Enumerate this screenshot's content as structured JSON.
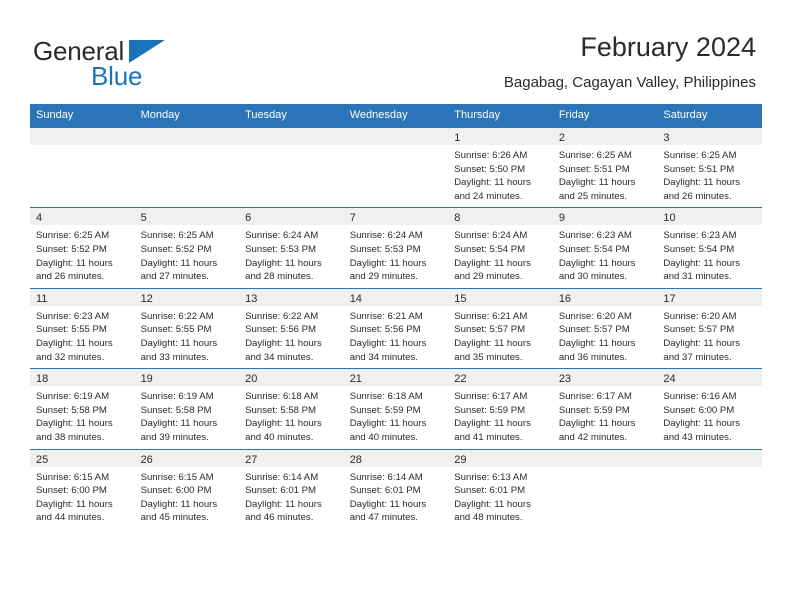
{
  "brand": {
    "name_part1": "General",
    "name_part2": "Blue",
    "triangle_color": "#1a74bb"
  },
  "header": {
    "title": "February 2024",
    "subtitle": "Bagabag, Cagayan Valley, Philippines"
  },
  "theme": {
    "header_blue": "#2b74b8",
    "daynum_band": "#f0f0f0",
    "text": "#2b2b2b"
  },
  "weekdays": [
    "Sunday",
    "Monday",
    "Tuesday",
    "Wednesday",
    "Thursday",
    "Friday",
    "Saturday"
  ],
  "weeks": [
    [
      {
        "day": "",
        "blank": true
      },
      {
        "day": "",
        "blank": true
      },
      {
        "day": "",
        "blank": true
      },
      {
        "day": "",
        "blank": true
      },
      {
        "day": "1",
        "sunrise": "Sunrise: 6:26 AM",
        "sunset": "Sunset: 5:50 PM",
        "daylight1": "Daylight: 11 hours",
        "daylight2": "and 24 minutes."
      },
      {
        "day": "2",
        "sunrise": "Sunrise: 6:25 AM",
        "sunset": "Sunset: 5:51 PM",
        "daylight1": "Daylight: 11 hours",
        "daylight2": "and 25 minutes."
      },
      {
        "day": "3",
        "sunrise": "Sunrise: 6:25 AM",
        "sunset": "Sunset: 5:51 PM",
        "daylight1": "Daylight: 11 hours",
        "daylight2": "and 26 minutes."
      }
    ],
    [
      {
        "day": "4",
        "sunrise": "Sunrise: 6:25 AM",
        "sunset": "Sunset: 5:52 PM",
        "daylight1": "Daylight: 11 hours",
        "daylight2": "and 26 minutes."
      },
      {
        "day": "5",
        "sunrise": "Sunrise: 6:25 AM",
        "sunset": "Sunset: 5:52 PM",
        "daylight1": "Daylight: 11 hours",
        "daylight2": "and 27 minutes."
      },
      {
        "day": "6",
        "sunrise": "Sunrise: 6:24 AM",
        "sunset": "Sunset: 5:53 PM",
        "daylight1": "Daylight: 11 hours",
        "daylight2": "and 28 minutes."
      },
      {
        "day": "7",
        "sunrise": "Sunrise: 6:24 AM",
        "sunset": "Sunset: 5:53 PM",
        "daylight1": "Daylight: 11 hours",
        "daylight2": "and 29 minutes."
      },
      {
        "day": "8",
        "sunrise": "Sunrise: 6:24 AM",
        "sunset": "Sunset: 5:54 PM",
        "daylight1": "Daylight: 11 hours",
        "daylight2": "and 29 minutes."
      },
      {
        "day": "9",
        "sunrise": "Sunrise: 6:23 AM",
        "sunset": "Sunset: 5:54 PM",
        "daylight1": "Daylight: 11 hours",
        "daylight2": "and 30 minutes."
      },
      {
        "day": "10",
        "sunrise": "Sunrise: 6:23 AM",
        "sunset": "Sunset: 5:54 PM",
        "daylight1": "Daylight: 11 hours",
        "daylight2": "and 31 minutes."
      }
    ],
    [
      {
        "day": "11",
        "sunrise": "Sunrise: 6:23 AM",
        "sunset": "Sunset: 5:55 PM",
        "daylight1": "Daylight: 11 hours",
        "daylight2": "and 32 minutes."
      },
      {
        "day": "12",
        "sunrise": "Sunrise: 6:22 AM",
        "sunset": "Sunset: 5:55 PM",
        "daylight1": "Daylight: 11 hours",
        "daylight2": "and 33 minutes."
      },
      {
        "day": "13",
        "sunrise": "Sunrise: 6:22 AM",
        "sunset": "Sunset: 5:56 PM",
        "daylight1": "Daylight: 11 hours",
        "daylight2": "and 34 minutes."
      },
      {
        "day": "14",
        "sunrise": "Sunrise: 6:21 AM",
        "sunset": "Sunset: 5:56 PM",
        "daylight1": "Daylight: 11 hours",
        "daylight2": "and 34 minutes."
      },
      {
        "day": "15",
        "sunrise": "Sunrise: 6:21 AM",
        "sunset": "Sunset: 5:57 PM",
        "daylight1": "Daylight: 11 hours",
        "daylight2": "and 35 minutes."
      },
      {
        "day": "16",
        "sunrise": "Sunrise: 6:20 AM",
        "sunset": "Sunset: 5:57 PM",
        "daylight1": "Daylight: 11 hours",
        "daylight2": "and 36 minutes."
      },
      {
        "day": "17",
        "sunrise": "Sunrise: 6:20 AM",
        "sunset": "Sunset: 5:57 PM",
        "daylight1": "Daylight: 11 hours",
        "daylight2": "and 37 minutes."
      }
    ],
    [
      {
        "day": "18",
        "sunrise": "Sunrise: 6:19 AM",
        "sunset": "Sunset: 5:58 PM",
        "daylight1": "Daylight: 11 hours",
        "daylight2": "and 38 minutes."
      },
      {
        "day": "19",
        "sunrise": "Sunrise: 6:19 AM",
        "sunset": "Sunset: 5:58 PM",
        "daylight1": "Daylight: 11 hours",
        "daylight2": "and 39 minutes."
      },
      {
        "day": "20",
        "sunrise": "Sunrise: 6:18 AM",
        "sunset": "Sunset: 5:58 PM",
        "daylight1": "Daylight: 11 hours",
        "daylight2": "and 40 minutes."
      },
      {
        "day": "21",
        "sunrise": "Sunrise: 6:18 AM",
        "sunset": "Sunset: 5:59 PM",
        "daylight1": "Daylight: 11 hours",
        "daylight2": "and 40 minutes."
      },
      {
        "day": "22",
        "sunrise": "Sunrise: 6:17 AM",
        "sunset": "Sunset: 5:59 PM",
        "daylight1": "Daylight: 11 hours",
        "daylight2": "and 41 minutes."
      },
      {
        "day": "23",
        "sunrise": "Sunrise: 6:17 AM",
        "sunset": "Sunset: 5:59 PM",
        "daylight1": "Daylight: 11 hours",
        "daylight2": "and 42 minutes."
      },
      {
        "day": "24",
        "sunrise": "Sunrise: 6:16 AM",
        "sunset": "Sunset: 6:00 PM",
        "daylight1": "Daylight: 11 hours",
        "daylight2": "and 43 minutes."
      }
    ],
    [
      {
        "day": "25",
        "sunrise": "Sunrise: 6:15 AM",
        "sunset": "Sunset: 6:00 PM",
        "daylight1": "Daylight: 11 hours",
        "daylight2": "and 44 minutes."
      },
      {
        "day": "26",
        "sunrise": "Sunrise: 6:15 AM",
        "sunset": "Sunset: 6:00 PM",
        "daylight1": "Daylight: 11 hours",
        "daylight2": "and 45 minutes."
      },
      {
        "day": "27",
        "sunrise": "Sunrise: 6:14 AM",
        "sunset": "Sunset: 6:01 PM",
        "daylight1": "Daylight: 11 hours",
        "daylight2": "and 46 minutes."
      },
      {
        "day": "28",
        "sunrise": "Sunrise: 6:14 AM",
        "sunset": "Sunset: 6:01 PM",
        "daylight1": "Daylight: 11 hours",
        "daylight2": "and 47 minutes."
      },
      {
        "day": "29",
        "sunrise": "Sunrise: 6:13 AM",
        "sunset": "Sunset: 6:01 PM",
        "daylight1": "Daylight: 11 hours",
        "daylight2": "and 48 minutes."
      },
      {
        "day": "",
        "blank": true
      },
      {
        "day": "",
        "blank": true
      }
    ]
  ]
}
